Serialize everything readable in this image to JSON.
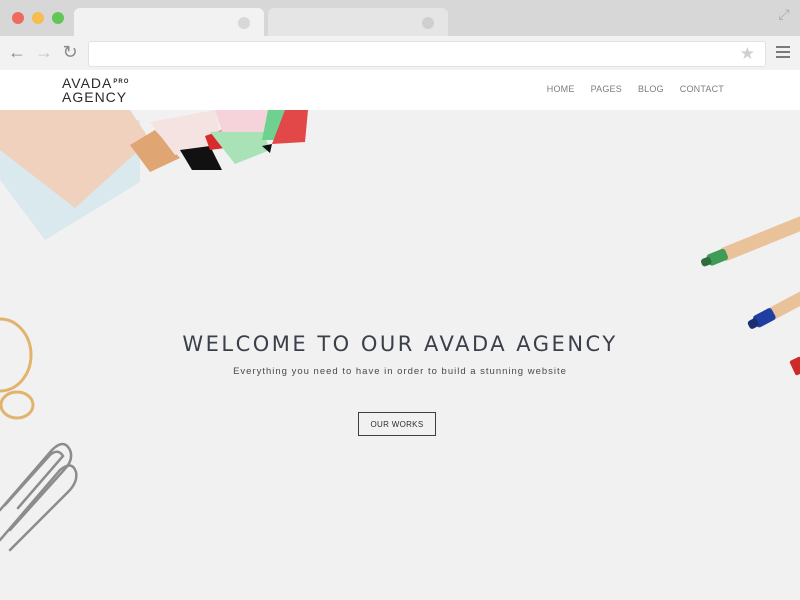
{
  "browser": {
    "tabs": [
      {
        "active": true
      },
      {
        "active": false
      }
    ],
    "address_value": "",
    "icons": {
      "back": "arrow-left",
      "forward": "arrow-right",
      "reload": "reload",
      "bookmark": "star",
      "menu": "hamburger",
      "expand": "expand-arrows"
    },
    "glyphs": {
      "back": "←",
      "forward": "→",
      "reload": "↻",
      "star": "★",
      "expand": "⤢"
    }
  },
  "site": {
    "logo": {
      "line1": "AVADA",
      "badge": "PRO",
      "line2": "AGENCY"
    },
    "nav": [
      {
        "label": "HOME"
      },
      {
        "label": "PAGES"
      },
      {
        "label": "BLOG"
      },
      {
        "label": "CONTACT"
      }
    ]
  },
  "hero": {
    "title": "WELCOME TO OUR AVADA AGENCY",
    "subtitle": "Everything you need to have in order to build a stunning website",
    "button_label": "OUR WORKS"
  },
  "colors": {
    "chrome_bg": "#d7d7d7",
    "hero_bg": "#f1f1f1",
    "title": "#3a3f4a"
  }
}
